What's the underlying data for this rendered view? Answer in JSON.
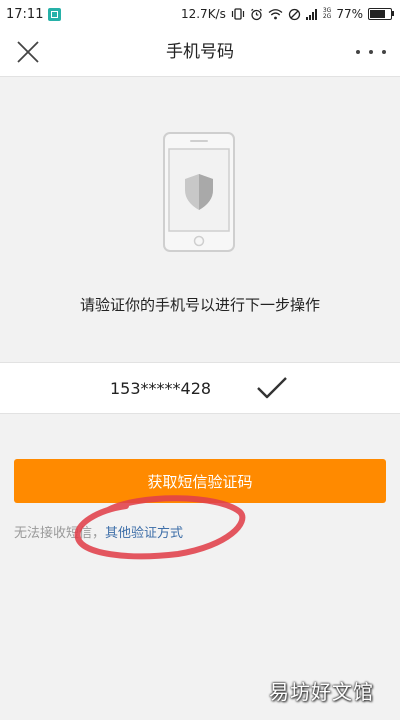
{
  "status_bar": {
    "time": "17:11",
    "network_speed": "12.7K/s",
    "network_type_top": "3G",
    "network_type_bottom": "2G",
    "battery_percent": "77%",
    "battery_level": 0.77
  },
  "nav": {
    "title": "手机号码"
  },
  "prompt": "请验证你的手机号以进行下一步操作",
  "phone": {
    "masked_number": "153*****428"
  },
  "get_code_button": "获取短信验证码",
  "alternative": {
    "prefix": "无法接收短信，",
    "link": "其他验证方式"
  },
  "watermark": "易坊好文馆",
  "colors": {
    "accent": "#ff8a00",
    "link": "#3d6ea8",
    "annotation": "#e0404a"
  }
}
